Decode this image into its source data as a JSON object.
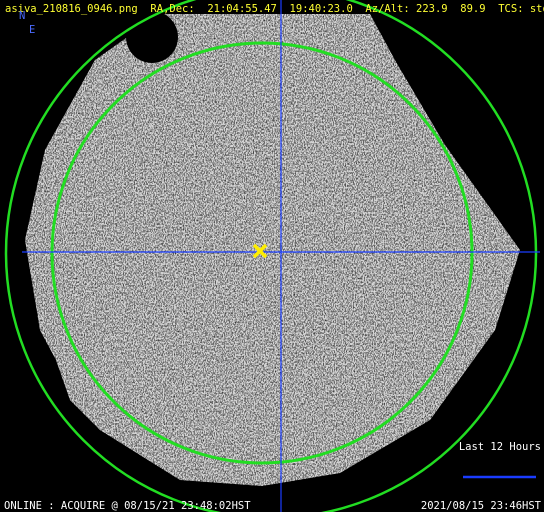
{
  "header": {
    "filename": "asiva_210816_0946.png",
    "ra_dec_label": "RA,Dec:",
    "ra": "21:04:55.47",
    "dec": "19:40:23.0",
    "az_alt_label": "Az/Alt:",
    "az": "223.9",
    "alt": "89.9",
    "tcs_label": "TCS:",
    "tcs_status": "stop"
  },
  "compass": {
    "north": "N",
    "east": "E"
  },
  "legend": {
    "trail_label": "Last 12 Hours"
  },
  "status": {
    "left": "ONLINE : ACQUIRE @ 08/15/21 23:48:02HST",
    "right": "2021/08/15 23:46HST"
  },
  "colors": {
    "text": "#ffffff",
    "header_text": "#ffff33",
    "compass": "#4a6bff",
    "circle": "#22dd22",
    "crosshair": "#1a3cff",
    "target_marker": "#ffee00",
    "background": "#000000"
  },
  "icons": {
    "target": "x-marker-icon"
  }
}
